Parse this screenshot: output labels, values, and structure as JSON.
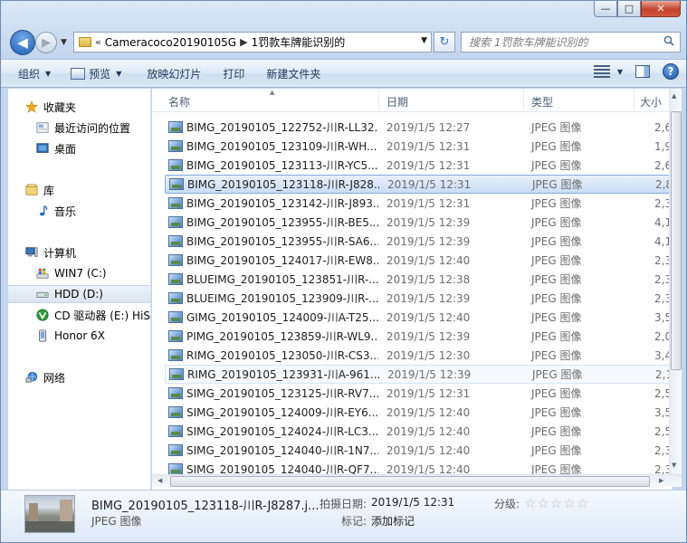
{
  "window": {
    "min_glyph": "—",
    "max_glyph": "□",
    "close_glyph": "✕"
  },
  "address": {
    "back_glyph": "◀",
    "fwd_glyph": "▶",
    "separator": "«",
    "segments": [
      "Cameracoco20190105G",
      "1罚款车牌能识别的"
    ],
    "refresh_glyph": "↻"
  },
  "search": {
    "placeholder": "搜索 1罚款车牌能识别的"
  },
  "toolbar": {
    "organize": "组织",
    "preview": "预览",
    "slideshow": "放映幻灯片",
    "print": "打印",
    "new_folder": "新建文件夹",
    "help": "?"
  },
  "nav": {
    "favorites": "收藏夹",
    "recent": "最近访问的位置",
    "desktop": "桌面",
    "libraries": "库",
    "music": "音乐",
    "computer": "计算机",
    "drive_c": "WIN7 (C:)",
    "drive_d": "HDD (D:)",
    "drive_e": "CD 驱动器 (E:) HiSu",
    "honor": "Honor 6X",
    "network": "网络"
  },
  "columns": {
    "name": "名称",
    "date": "日期",
    "type": "类型",
    "size": "大小"
  },
  "files": [
    {
      "name": "BIMG_20190105_122752-川R-LL32...",
      "date": "2019/1/5 12:27",
      "type": "JPEG 图像",
      "size": "2,6"
    },
    {
      "name": "BIMG_20190105_123109-川R-WH...",
      "date": "2019/1/5 12:31",
      "type": "JPEG 图像",
      "size": "1,9"
    },
    {
      "name": "BIMG_20190105_123113-川R-YC5...",
      "date": "2019/1/5 12:31",
      "type": "JPEG 图像",
      "size": "2,6"
    },
    {
      "name": "BIMG_20190105_123118-川R-J828...",
      "date": "2019/1/5 12:31",
      "type": "JPEG 图像",
      "size": "2,8"
    },
    {
      "name": "BIMG_20190105_123142-川R-J893...",
      "date": "2019/1/5 12:31",
      "type": "JPEG 图像",
      "size": "2,3"
    },
    {
      "name": "BIMG_20190105_123955-川R-BE5...",
      "date": "2019/1/5 12:39",
      "type": "JPEG 图像",
      "size": "4,1"
    },
    {
      "name": "BIMG_20190105_123955-川R-SA6...",
      "date": "2019/1/5 12:39",
      "type": "JPEG 图像",
      "size": "4,1"
    },
    {
      "name": "BIMG_20190105_124017-川R-EW8...",
      "date": "2019/1/5 12:40",
      "type": "JPEG 图像",
      "size": "2,3"
    },
    {
      "name": "BLUEIMG_20190105_123851-川R-...",
      "date": "2019/1/5 12:38",
      "type": "JPEG 图像",
      "size": "2,3"
    },
    {
      "name": "BLUEIMG_20190105_123909-川R-...",
      "date": "2019/1/5 12:39",
      "type": "JPEG 图像",
      "size": "2,3"
    },
    {
      "name": "GIMG_20190105_124009-川A-T25...",
      "date": "2019/1/5 12:40",
      "type": "JPEG 图像",
      "size": "3,5"
    },
    {
      "name": "PIMG_20190105_123859-川R-WL9...",
      "date": "2019/1/5 12:39",
      "type": "JPEG 图像",
      "size": "2,0"
    },
    {
      "name": "RIMG_20190105_123050-川R-CS3...",
      "date": "2019/1/5 12:30",
      "type": "JPEG 图像",
      "size": "3,4"
    },
    {
      "name": "RIMG_20190105_123931-川A-961...",
      "date": "2019/1/5 12:39",
      "type": "JPEG 图像",
      "size": "2,1"
    },
    {
      "name": "SIMG_20190105_123125-川R-RV7...",
      "date": "2019/1/5 12:31",
      "type": "JPEG 图像",
      "size": "2,5"
    },
    {
      "name": "SIMG_20190105_124009-川R-EY6...",
      "date": "2019/1/5 12:40",
      "type": "JPEG 图像",
      "size": "3,5"
    },
    {
      "name": "SIMG_20190105_124024-川R-LC3...",
      "date": "2019/1/5 12:40",
      "type": "JPEG 图像",
      "size": "2,5"
    },
    {
      "name": "SIMG_20190105_124040-川R-1N7...",
      "date": "2019/1/5 12:40",
      "type": "JPEG 图像",
      "size": "2,3"
    },
    {
      "name": "SIMG_20190105_124040-川R-QF7...",
      "date": "2019/1/5 12:40",
      "type": "JPEG 图像",
      "size": "2,3"
    }
  ],
  "selected_index": 3,
  "hover_index": 13,
  "details": {
    "name": "BIMG_20190105_123118-川R-J8287.j...",
    "type": "JPEG 图像",
    "date_label": "拍摄日期:",
    "date_value": "2019/1/5 12:31",
    "tags_label": "标记:",
    "tags_value": "添加标记",
    "rating_label": "分级:",
    "rating_value": 0,
    "rating_max": 5
  },
  "colors": {
    "selection_border": "#84acdd",
    "accent_blue": "#1d5fb5",
    "favorites_star": "#f0a81c"
  }
}
